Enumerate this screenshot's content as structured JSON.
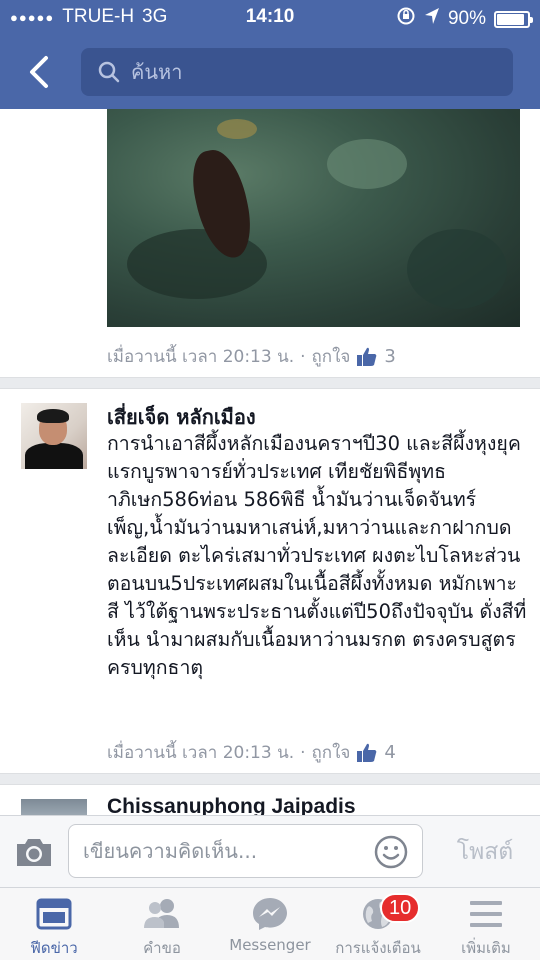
{
  "status_bar": {
    "carrier": "TRUE-H",
    "network": "3G",
    "time": "14:10",
    "battery": "90%",
    "battery_level": 0.9
  },
  "nav": {
    "search_placeholder": "ค้นหา"
  },
  "feed": {
    "post1_meta": {
      "timestamp": "เมื่อวานนี้ เวลา 20:13 น.",
      "separator": "·",
      "like_label": "ถูกใจ",
      "like_count": "3"
    },
    "post2": {
      "author": "เสี่ยเจ็ด หลักเมือง",
      "text": "การนำเอาสีผึ้งหลักเมืองนคราฯปี30 และสีผึ้งหุงยุคแรกบูรพาจารย์ทั่วประเทศ เทียชัยพิธีพุทธาภิเษก586ท่อน 586พิธี น้ำมันว่านเจ็ดจันทร์เพ็ญ,น้ำมันว่านมหาเสน่ห์,มหาว่านและกาฝากบดละเอียด ตะไคร่เสมาทั่วประเทศ ผงตะไบโลหะส่วนตอนบน5ประเทศผสมในเนื้อสีผึ้งทั้งหมด หมักเพาะสี ไว้ใต้ฐานพระประธานตั้งแต่ปี50ถึงปัจจุบัน ดั่งสีที่เห็น นำมาผสมกับเนื้อมหาว่านมรกต ตรงครบสูตรครบทุกธาตุ",
      "timestamp": "เมื่อวานนี้ เวลา 20:13 น.",
      "separator": "·",
      "like_label": "ถูกใจ",
      "like_count": "4"
    },
    "post3": {
      "author": "Chissanuphong Jaipadis"
    }
  },
  "composer": {
    "placeholder": "เขียนความคิดเห็น...",
    "post_label": "โพสต์"
  },
  "tabs": [
    {
      "label": "ฟีดข่าว",
      "icon": "news-feed-icon",
      "active": true
    },
    {
      "label": "คำขอ",
      "icon": "friend-requests-icon"
    },
    {
      "label": "Messenger",
      "icon": "messenger-icon"
    },
    {
      "label": "การแจ้งเตือน",
      "icon": "globe-notifications-icon",
      "badge": "10"
    },
    {
      "label": "เพิ่มเติม",
      "icon": "menu-icon"
    }
  ],
  "colors": {
    "brand": "#4a67a8",
    "badge": "#e62d2d"
  }
}
